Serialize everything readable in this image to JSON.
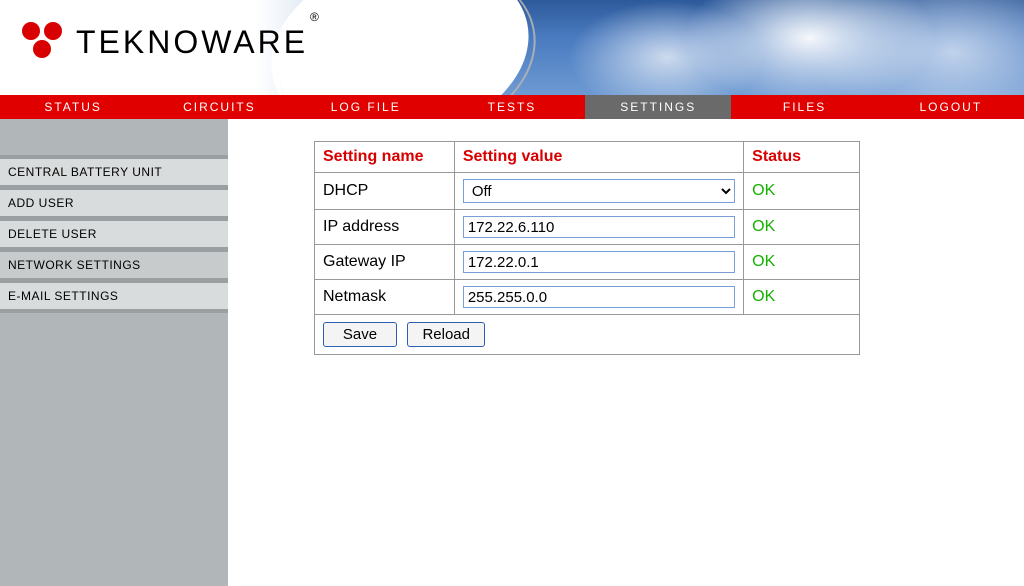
{
  "brand": {
    "name": "TEKNOWARE",
    "reg": "®"
  },
  "nav": {
    "items": [
      {
        "id": "status",
        "label": "STATUS",
        "active": false
      },
      {
        "id": "circuits",
        "label": "CIRCUITS",
        "active": false
      },
      {
        "id": "logfile",
        "label": "LOG FILE",
        "active": false
      },
      {
        "id": "tests",
        "label": "TESTS",
        "active": false
      },
      {
        "id": "settings",
        "label": "SETTINGS",
        "active": true
      },
      {
        "id": "files",
        "label": "FILES",
        "active": false
      },
      {
        "id": "logout",
        "label": "LOGOUT",
        "active": false
      }
    ]
  },
  "sidebar": {
    "items": [
      {
        "id": "central-battery-unit",
        "label": "CENTRAL BATTERY UNIT",
        "active": false
      },
      {
        "id": "add-user",
        "label": "ADD USER",
        "active": false
      },
      {
        "id": "delete-user",
        "label": "DELETE USER",
        "active": false
      },
      {
        "id": "network-settings",
        "label": "NETWORK SETTINGS",
        "active": true
      },
      {
        "id": "email-settings",
        "label": "E-MAIL SETTINGS",
        "active": false
      }
    ]
  },
  "table": {
    "headers": {
      "name": "Setting name",
      "value": "Setting value",
      "status": "Status"
    },
    "rows": [
      {
        "name": "DHCP",
        "type": "select",
        "value": "Off",
        "status": "OK"
      },
      {
        "name": "IP address",
        "type": "text",
        "value": "172.22.6.110",
        "status": "OK"
      },
      {
        "name": "Gateway IP",
        "type": "text",
        "value": "172.22.0.1",
        "status": "OK"
      },
      {
        "name": "Netmask",
        "type": "text",
        "value": "255.255.0.0",
        "status": "OK"
      }
    ],
    "buttons": {
      "save": "Save",
      "reload": "Reload"
    }
  }
}
